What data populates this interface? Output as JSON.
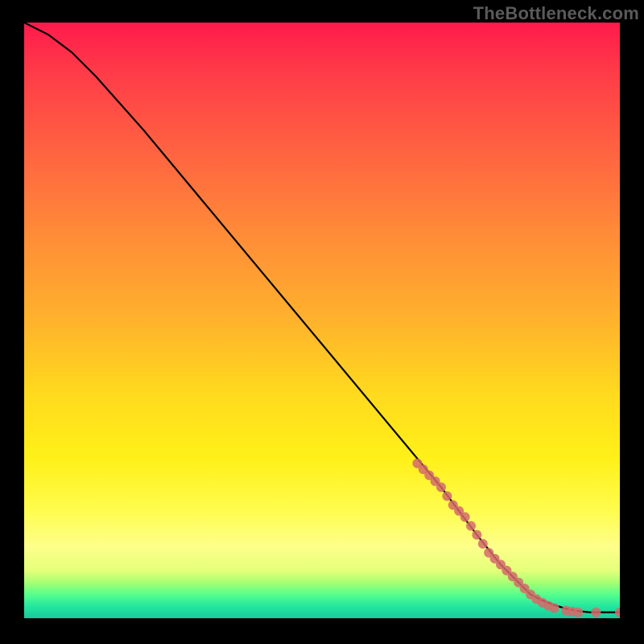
{
  "watermark": "TheBottleneck.com",
  "chart_data": {
    "type": "line",
    "title": "",
    "xlabel": "",
    "ylabel": "",
    "xlim": [
      0,
      100
    ],
    "ylim": [
      0,
      100
    ],
    "grid": false,
    "series": [
      {
        "name": "curve",
        "x": [
          0,
          4,
          8,
          12,
          20,
          30,
          40,
          50,
          60,
          70,
          76,
          80,
          83,
          85,
          87,
          89,
          91,
          93,
          95,
          100
        ],
        "y": [
          100,
          98,
          95,
          91,
          82,
          70,
          58,
          46,
          34,
          22,
          14,
          9,
          6,
          4,
          3,
          2.2,
          1.6,
          1.2,
          1,
          1
        ]
      }
    ],
    "markers": {
      "name": "scatter-dots",
      "color": "#d46a6a",
      "x": [
        66,
        67,
        68,
        69,
        70,
        71,
        72,
        73,
        74,
        75,
        76,
        77,
        78,
        79,
        80,
        81,
        82,
        83,
        84,
        85,
        86,
        87,
        88,
        89,
        91,
        92,
        93,
        96,
        100
      ],
      "y": [
        26,
        25,
        24,
        23,
        22,
        20.5,
        19,
        18,
        17,
        15.5,
        14,
        12.5,
        11,
        10,
        9,
        8,
        7,
        6,
        5,
        4,
        3.2,
        2.6,
        2.1,
        1.7,
        1.3,
        1.1,
        1,
        1,
        1
      ]
    },
    "background_gradient": {
      "orientation": "vertical",
      "stops": [
        {
          "pos": 0.0,
          "color": "#ff1a4c"
        },
        {
          "pos": 0.35,
          "color": "#ff8a38"
        },
        {
          "pos": 0.62,
          "color": "#ffd91e"
        },
        {
          "pos": 0.88,
          "color": "#fdff8a"
        },
        {
          "pos": 0.96,
          "color": "#56ff8c"
        },
        {
          "pos": 1.0,
          "color": "#19c99a"
        }
      ]
    }
  }
}
